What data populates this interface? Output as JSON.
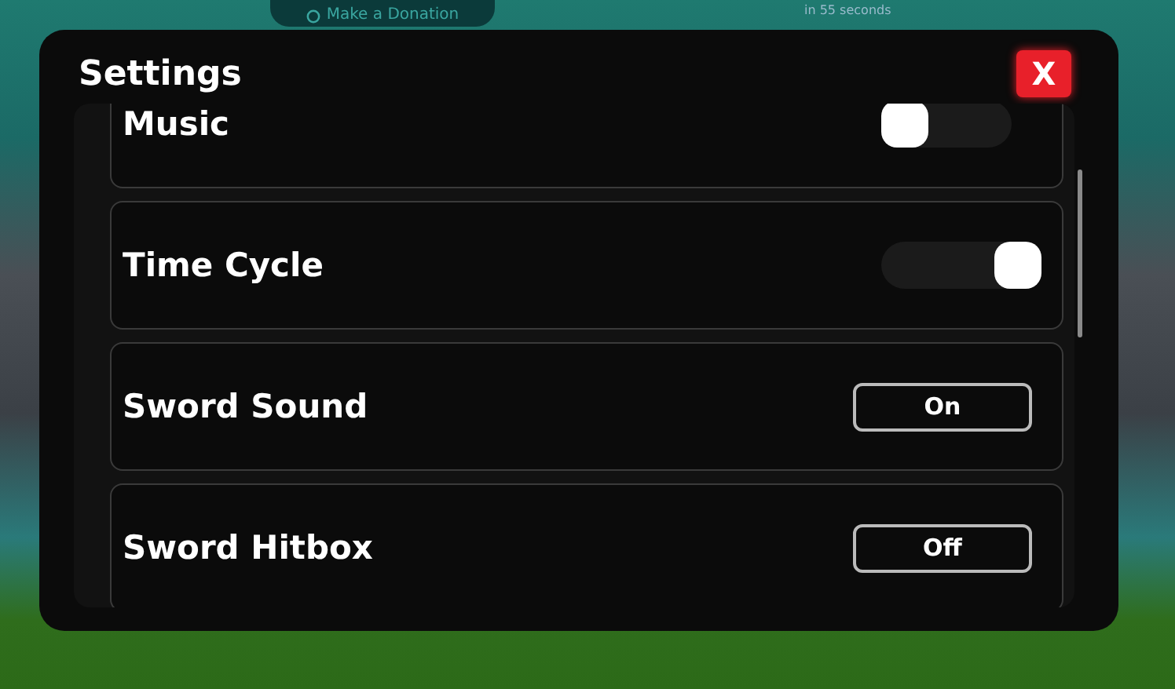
{
  "background": {
    "donation_button": "Make a Donation",
    "notice": "in 55 seconds"
  },
  "panel": {
    "title": "Settings",
    "close": "X",
    "rows": [
      {
        "label": "Music",
        "kind": "toggle",
        "on": false
      },
      {
        "label": "Time Cycle",
        "kind": "toggle",
        "on": true
      },
      {
        "label": "Sword Sound",
        "kind": "button",
        "value": "On"
      },
      {
        "label": "Sword Hitbox",
        "kind": "button",
        "value": "Off"
      }
    ]
  }
}
